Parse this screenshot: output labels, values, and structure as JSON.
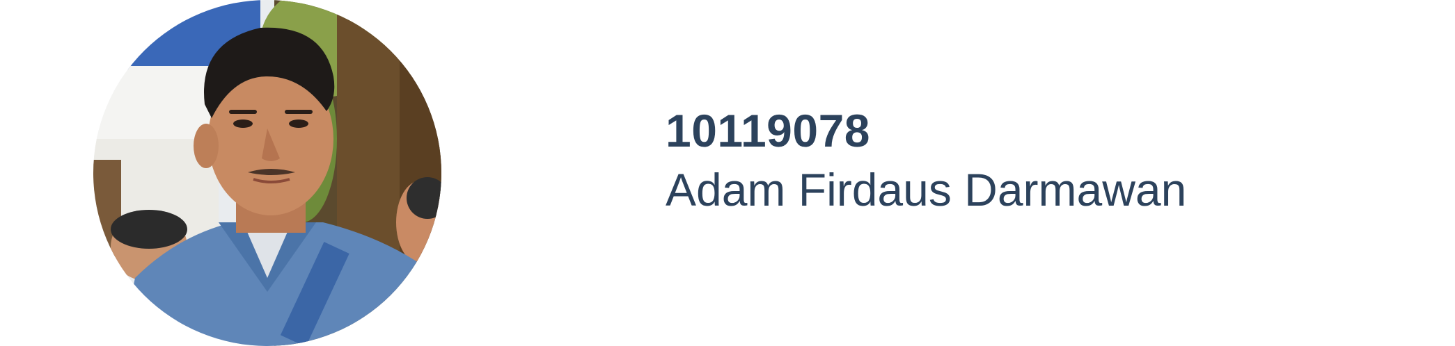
{
  "profile": {
    "student_id": "10119078",
    "full_name": "Adam Firdaus Darmawan",
    "avatar_icon": "profile-photo",
    "text_color": "#2c425c"
  }
}
